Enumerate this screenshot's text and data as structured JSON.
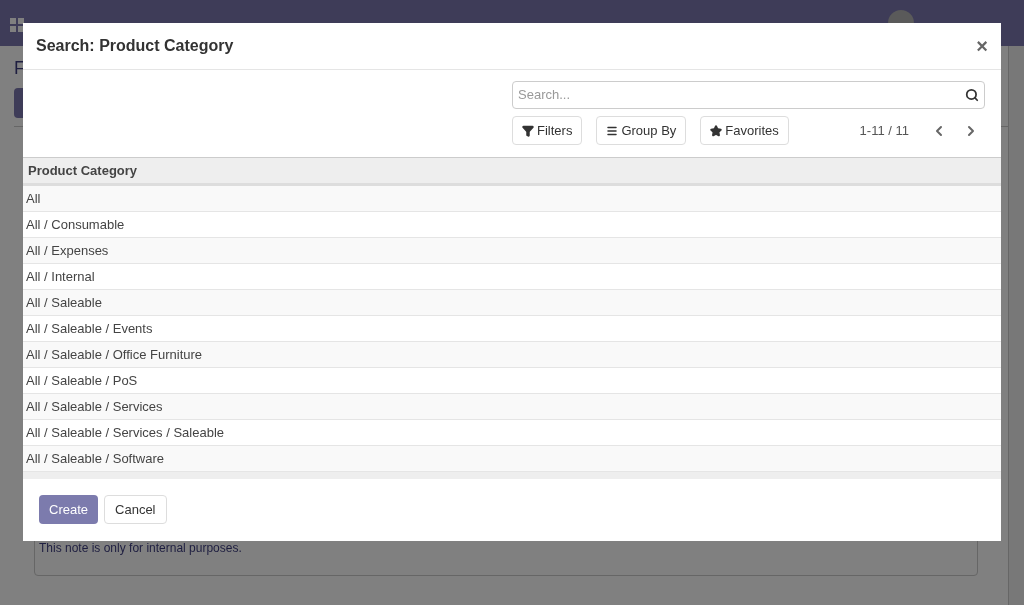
{
  "background": {
    "breadcrumb": "F",
    "note": "This note is only for internal purposes."
  },
  "dialog": {
    "title": "Search: Product Category",
    "close": "×",
    "search": {
      "placeholder": "Search..."
    },
    "buttons": [
      {
        "kind": "filter",
        "label": "Filters"
      },
      {
        "kind": "group",
        "label": "Group By"
      },
      {
        "kind": "favorite",
        "label": "Favorites"
      }
    ],
    "pager": "1-11 / 11",
    "table": {
      "columns": [
        "Product Category"
      ],
      "rows": [
        "All",
        "All / Consumable",
        "All / Expenses",
        "All / Internal",
        "All / Saleable",
        "All / Saleable / Events",
        "All / Saleable / Office Furniture",
        "All / Saleable / PoS",
        "All / Saleable / Services",
        "All / Saleable / Services / Saleable",
        "All / Saleable / Software"
      ]
    },
    "footer": [
      {
        "kind": "primary",
        "label": "Create"
      },
      {
        "kind": "secondary",
        "label": "Cancel"
      }
    ]
  }
}
